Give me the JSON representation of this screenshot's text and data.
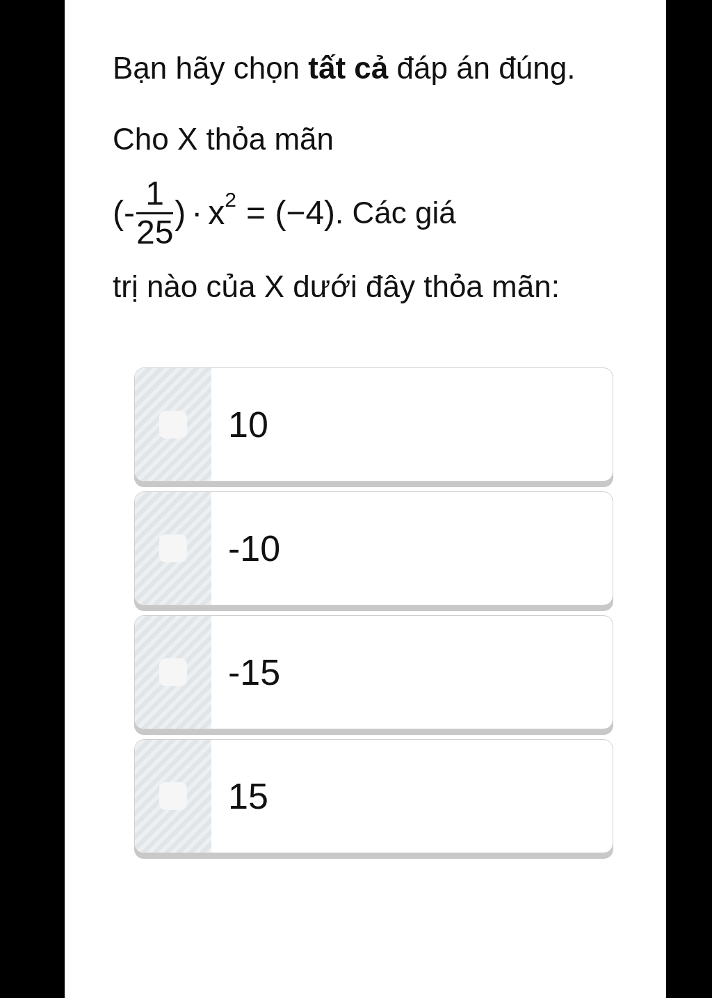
{
  "instruction": "Bạn hãy chọn **tất cả** đáp án đúng.",
  "question": {
    "before": "Cho X thỏa mãn",
    "formula": {
      "open": "(-",
      "numerator": "1",
      "denominator": "25",
      "close": ")",
      "operator": "·",
      "variable": "x",
      "exponent": "2",
      "rhs": "= (−4)"
    },
    "tail": ". Các giá",
    "after": "trị nào của X dưới đây thỏa mãn:"
  },
  "options": [
    {
      "label": "10",
      "checked": false
    },
    {
      "label": "-10",
      "checked": false
    },
    {
      "label": "-15",
      "checked": false
    },
    {
      "label": "15",
      "checked": false
    }
  ]
}
